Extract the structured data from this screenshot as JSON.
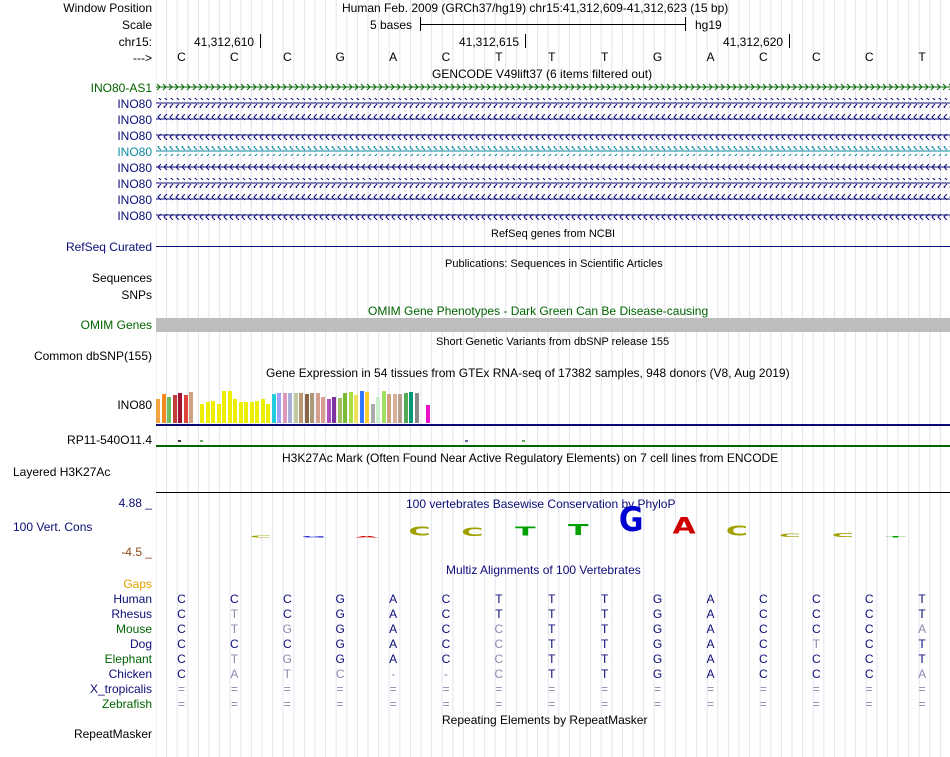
{
  "labels": {
    "window_position": "Window Position",
    "scale": "Scale",
    "chrom": "chr15:",
    "arrow": "--->",
    "ino80_as1": "INO80-AS1",
    "ino80": "INO80",
    "refseq": "RefSeq Curated",
    "sequences": "Sequences",
    "snps": "SNPs",
    "omim": "OMIM Genes",
    "common_dbsnp": "Common dbSNP(155)",
    "gtex_gene": "INO80",
    "rp11": "RP11-540O11.4",
    "layered": "Layered H3K27Ac",
    "cons_max": "4.88 _",
    "cons_label": "100 Vert. Cons",
    "cons_min": "-4.5 _",
    "gaps": "Gaps",
    "species": [
      "Human",
      "Rhesus",
      "Mouse",
      "Dog",
      "Elephant",
      "Chicken",
      "X_tropicalis",
      "Zebrafish"
    ],
    "repeatmasker": "RepeatMasker"
  },
  "header": {
    "assembly": "Human Feb. 2009 (GRCh37/hg19)   chr15:41,312,609-41,312,623 (15 bp)",
    "scale_text": "5 bases",
    "scale_db": "hg19",
    "pos1": "41,312,610",
    "pos2": "41,312,615",
    "pos3": "41,312,620"
  },
  "bases": [
    "C",
    "C",
    "C",
    "G",
    "A",
    "C",
    "T",
    "T",
    "T",
    "G",
    "A",
    "C",
    "C",
    "C",
    "T"
  ],
  "titles": {
    "gencode": "GENCODE V49lift37 (6 items filtered out)",
    "refseq": "RefSeq genes from NCBI",
    "publications": "Publications: Sequences in Scientific Articles",
    "omim": "OMIM Gene Phenotypes - Dark Green Can Be Disease-causing",
    "snp": "Short Genetic Variants from dbSNP release 155",
    "gtex": "Gene Expression in 54 tissues from GTEx RNA-seq of 17382 samples, 948 donors (V8, Aug 2019)",
    "h3k27": "H3K27Ac Mark (Often Found Near Active Regulatory Elements) on 7 cell lines from ENCODE",
    "phylop": "100 vertebrates Basewise Conservation by PhyloP",
    "multiz": "Multiz Alignments of 100 Vertebrates",
    "repeat": "Repeating Elements by RepeatMasker"
  },
  "alignment": [
    [
      "C",
      "C",
      "C",
      "G",
      "A",
      "C",
      "T",
      "T",
      "T",
      "G",
      "A",
      "C",
      "C",
      "C",
      "T"
    ],
    [
      "C",
      "T",
      "C",
      "G",
      "A",
      "C",
      "T",
      "T",
      "T",
      "G",
      "A",
      "C",
      "C",
      "C",
      "T"
    ],
    [
      "C",
      "T",
      "G",
      "G",
      "A",
      "C",
      "C",
      "T",
      "T",
      "G",
      "A",
      "C",
      "C",
      "C",
      "A"
    ],
    [
      "C",
      "C",
      "C",
      "G",
      "A",
      "C",
      "C",
      "T",
      "T",
      "G",
      "A",
      "C",
      "T",
      "C",
      "T"
    ],
    [
      "C",
      "T",
      "G",
      "G",
      "A",
      "C",
      "C",
      "T",
      "T",
      "G",
      "A",
      "C",
      "C",
      "C",
      "T"
    ],
    [
      "C",
      "A",
      "T",
      "C",
      "-",
      "-",
      "C",
      "T",
      "T",
      "G",
      "A",
      "C",
      "C",
      "C",
      "A"
    ],
    [
      "=",
      "=",
      "=",
      "=",
      "=",
      "=",
      "=",
      "=",
      "=",
      "=",
      "=",
      "=",
      "=",
      "=",
      "="
    ],
    [
      "=",
      "=",
      "=",
      "=",
      "=",
      "=",
      "=",
      "=",
      "=",
      "=",
      "=",
      "=",
      "=",
      "=",
      "="
    ]
  ],
  "alignment_dim": [
    [
      0,
      0,
      0,
      0,
      0,
      0,
      0,
      0,
      0,
      0,
      0,
      0,
      0,
      0,
      0
    ],
    [
      0,
      1,
      0,
      0,
      0,
      0,
      0,
      0,
      0,
      0,
      0,
      0,
      0,
      0,
      0
    ],
    [
      0,
      1,
      1,
      0,
      0,
      0,
      1,
      0,
      0,
      0,
      0,
      0,
      0,
      0,
      1
    ],
    [
      0,
      0,
      0,
      0,
      0,
      0,
      1,
      0,
      0,
      0,
      0,
      0,
      1,
      0,
      0
    ],
    [
      0,
      1,
      1,
      0,
      0,
      0,
      1,
      0,
      0,
      0,
      0,
      0,
      0,
      0,
      0
    ],
    [
      0,
      1,
      1,
      1,
      1,
      1,
      1,
      0,
      0,
      0,
      0,
      0,
      0,
      0,
      1
    ],
    [
      1,
      1,
      1,
      1,
      1,
      1,
      1,
      1,
      1,
      1,
      1,
      1,
      1,
      1,
      1
    ],
    [
      1,
      1,
      1,
      1,
      1,
      1,
      1,
      1,
      1,
      1,
      1,
      1,
      1,
      1,
      1
    ]
  ],
  "phylop": [
    {
      "base": "",
      "score": 0.1,
      "color": "#00a000"
    },
    {
      "base": "C",
      "score": 0.4,
      "color": "#a0a000"
    },
    {
      "base": "G",
      "score": 0.2,
      "color": "#0000d0"
    },
    {
      "base": "A",
      "score": 0.3,
      "color": "#d00000"
    },
    {
      "base": "C",
      "score": 1.8,
      "color": "#a0a000"
    },
    {
      "base": "C",
      "score": 1.6,
      "color": "#a0a000"
    },
    {
      "base": "T",
      "score": 1.8,
      "color": "#00a000"
    },
    {
      "base": "T",
      "score": 2.2,
      "color": "#00a000"
    },
    {
      "base": "G",
      "score": 4.88,
      "color": "#0000d0"
    },
    {
      "base": "A",
      "score": 3.2,
      "color": "#d00000"
    },
    {
      "base": "C",
      "score": 1.9,
      "color": "#a0a000"
    },
    {
      "base": "C",
      "score": 0.6,
      "color": "#a0a000"
    },
    {
      "base": "C",
      "score": 0.7,
      "color": "#a0a000"
    },
    {
      "base": "T",
      "score": 0.1,
      "color": "#00a000"
    }
  ],
  "gtex_bars": [
    {
      "h": 0.55,
      "c": "#f2a340"
    },
    {
      "h": 0.68,
      "c": "#f08a1c"
    },
    {
      "h": 0.6,
      "c": "#6cbf5a"
    },
    {
      "h": 0.65,
      "c": "#c43b3b"
    },
    {
      "h": 0.7,
      "c": "#a31230"
    },
    {
      "h": 0.66,
      "c": "#e0443b"
    },
    {
      "h": 0.72,
      "c": "#d0a080"
    },
    {
      "h": 0.0,
      "c": "#ffffff"
    },
    {
      "h": 0.45,
      "c": "#eeee00"
    },
    {
      "h": 0.48,
      "c": "#eeee00"
    },
    {
      "h": 0.52,
      "c": "#eeee00"
    },
    {
      "h": 0.45,
      "c": "#eeee00"
    },
    {
      "h": 0.75,
      "c": "#eeee00"
    },
    {
      "h": 0.74,
      "c": "#eeee00"
    },
    {
      "h": 0.55,
      "c": "#eeee00"
    },
    {
      "h": 0.5,
      "c": "#eeee00"
    },
    {
      "h": 0.5,
      "c": "#eeee00"
    },
    {
      "h": 0.48,
      "c": "#eeee00"
    },
    {
      "h": 0.52,
      "c": "#eeee00"
    },
    {
      "h": 0.55,
      "c": "#eeee00"
    },
    {
      "h": 0.45,
      "c": "#eeee00"
    },
    {
      "h": 0.68,
      "c": "#22ccdd"
    },
    {
      "h": 0.7,
      "c": "#a0a0ff"
    },
    {
      "h": 0.7,
      "c": "#dd99bb"
    },
    {
      "h": 0.7,
      "c": "#a8b0d8"
    },
    {
      "h": 0.7,
      "c": "#c0c8a0"
    },
    {
      "h": 0.7,
      "c": "#b89870"
    },
    {
      "h": 0.68,
      "c": "#886644"
    },
    {
      "h": 0.7,
      "c": "#aa9977"
    },
    {
      "h": 0.7,
      "c": "#d4a090"
    },
    {
      "h": 0.6,
      "c": "#d4a090"
    },
    {
      "h": 0.55,
      "c": "#b050c0"
    },
    {
      "h": 0.6,
      "c": "#8030a0"
    },
    {
      "h": 0.58,
      "c": "#a0c060"
    },
    {
      "h": 0.7,
      "c": "#77bb33"
    },
    {
      "h": 0.72,
      "c": "#aadd44"
    },
    {
      "h": 0.65,
      "c": "#f0e060"
    },
    {
      "h": 0.75,
      "c": "#3377ff"
    },
    {
      "h": 0.72,
      "c": "#ffcc33"
    },
    {
      "h": 0.45,
      "c": "#aaaaaa"
    },
    {
      "h": 0.6,
      "c": "#cceecc"
    },
    {
      "h": 0.75,
      "c": "#9fe060"
    },
    {
      "h": 0.68,
      "c": "#d0a080"
    },
    {
      "h": 0.68,
      "c": "#d8b098"
    },
    {
      "h": 0.68,
      "c": "#b8a090"
    },
    {
      "h": 0.7,
      "c": "#55aa55"
    },
    {
      "h": 0.72,
      "c": "#009977"
    },
    {
      "h": 0.7,
      "c": "#888888"
    },
    {
      "h": 0.0,
      "c": "#ffffff"
    },
    {
      "h": 0.42,
      "c": "#ee11cc"
    }
  ]
}
